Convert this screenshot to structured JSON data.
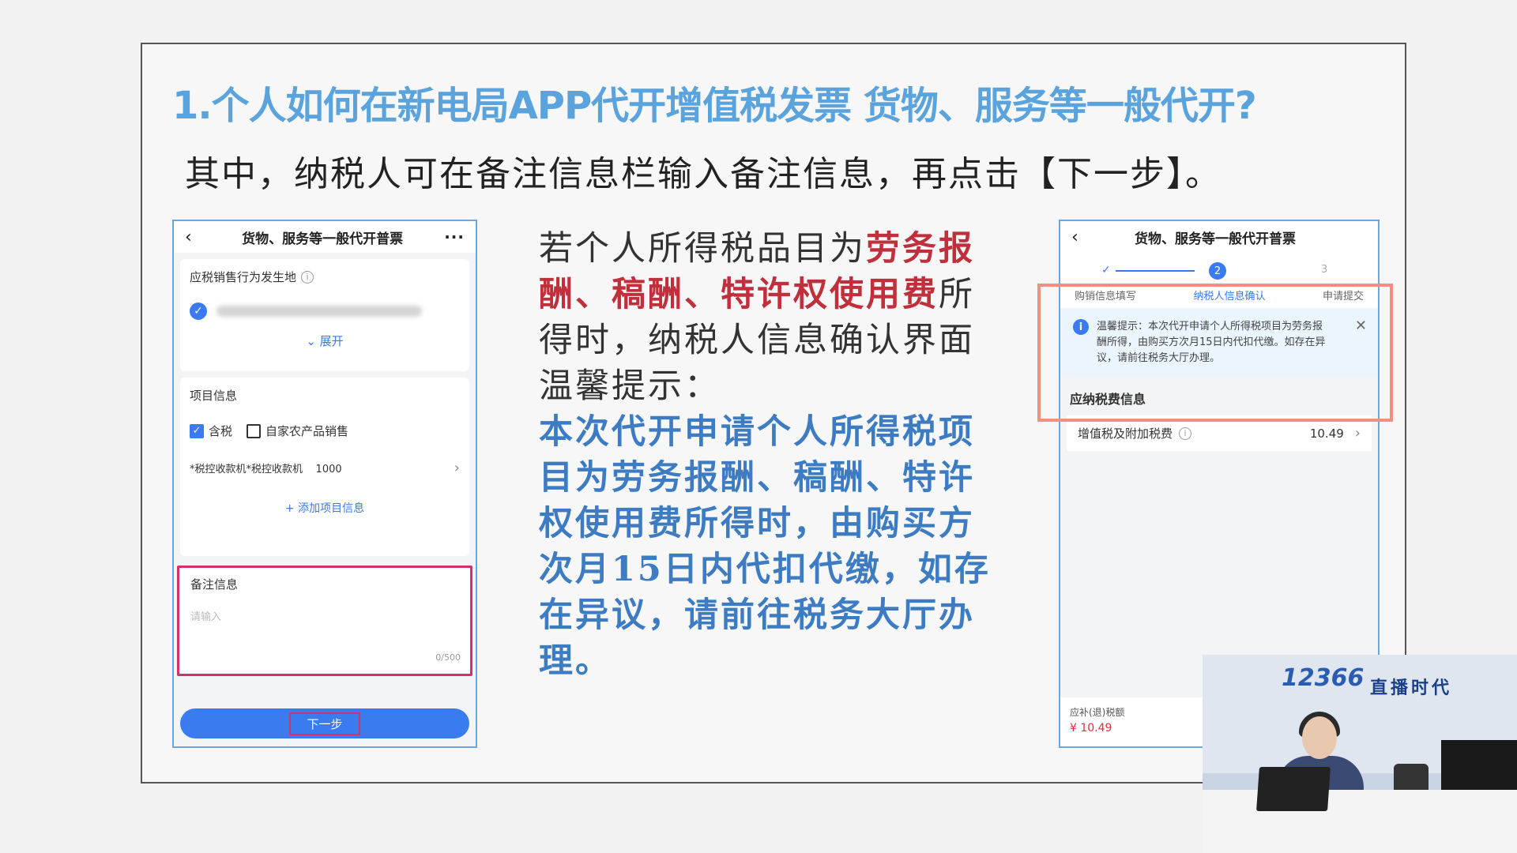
{
  "slide": {
    "title": "1.个人如何在新电局APP代开增值税发票 货物、服务等一般代开?",
    "subtitle": "其中，纳税人可在备注信息栏输入备注信息，再点击【下一步】。"
  },
  "left_phone": {
    "back_icon": "‹",
    "header_title": "货物、服务等一般代开普票",
    "more_icon": "···",
    "location_label": "应税销售行为发生地",
    "expand_label": "展开",
    "project_title": "项目信息",
    "tax_included_label": "含税",
    "self_produce_label": "自家农产品销售",
    "item_name": "*税控收款机*税控收款机",
    "item_amount": "1000",
    "add_item_label": "添加项目信息",
    "remark_title": "备注信息",
    "remark_placeholder": "请输入",
    "remark_counter": "0/500",
    "next_button": "下一步"
  },
  "middle": {
    "p1_a": "若个人所得税品目为",
    "p1_red": "劳务报酬、稿酬、特许权使用费",
    "p1_b": "所得时，纳税人信息确认界面温馨提示：",
    "p2_blue": "本次代开申请个人所得税项目为劳务报酬、稿酬、特许权使用费所得时，由购买方次月15日内代扣代缴，如存在异议，请前往税务大厅办理。"
  },
  "right_phone": {
    "back_icon": "‹",
    "header_title": "货物、服务等一般代开普票",
    "step1_mark": "✓",
    "step2_num": "2",
    "step3_num": "3",
    "step1_label": "购销信息填写",
    "step2_label": "纳税人信息确认",
    "step3_label": "申请提交",
    "tip_text": "温馨提示：本次代开申请个人所得税项目为劳务报酬所得，由购买方次月15日内代扣代缴。如存在异议，请前往税务大厅办理。",
    "section_title": "应纳税费信息",
    "tax_label": "增值税及附加税费",
    "tax_value": "10.49",
    "bottom_label": "应补(退)税额",
    "bottom_value": "¥ 10.49"
  },
  "video": {
    "logo": "12366",
    "brand": "直播时代"
  },
  "colors": {
    "title_blue": "#5aa3dc",
    "accent_red": "#c0303c",
    "text_blue": "#3d7cc2",
    "app_blue": "#3a7bf0",
    "highlight_pink": "#d6306a",
    "highlight_salmon": "#f09080"
  }
}
